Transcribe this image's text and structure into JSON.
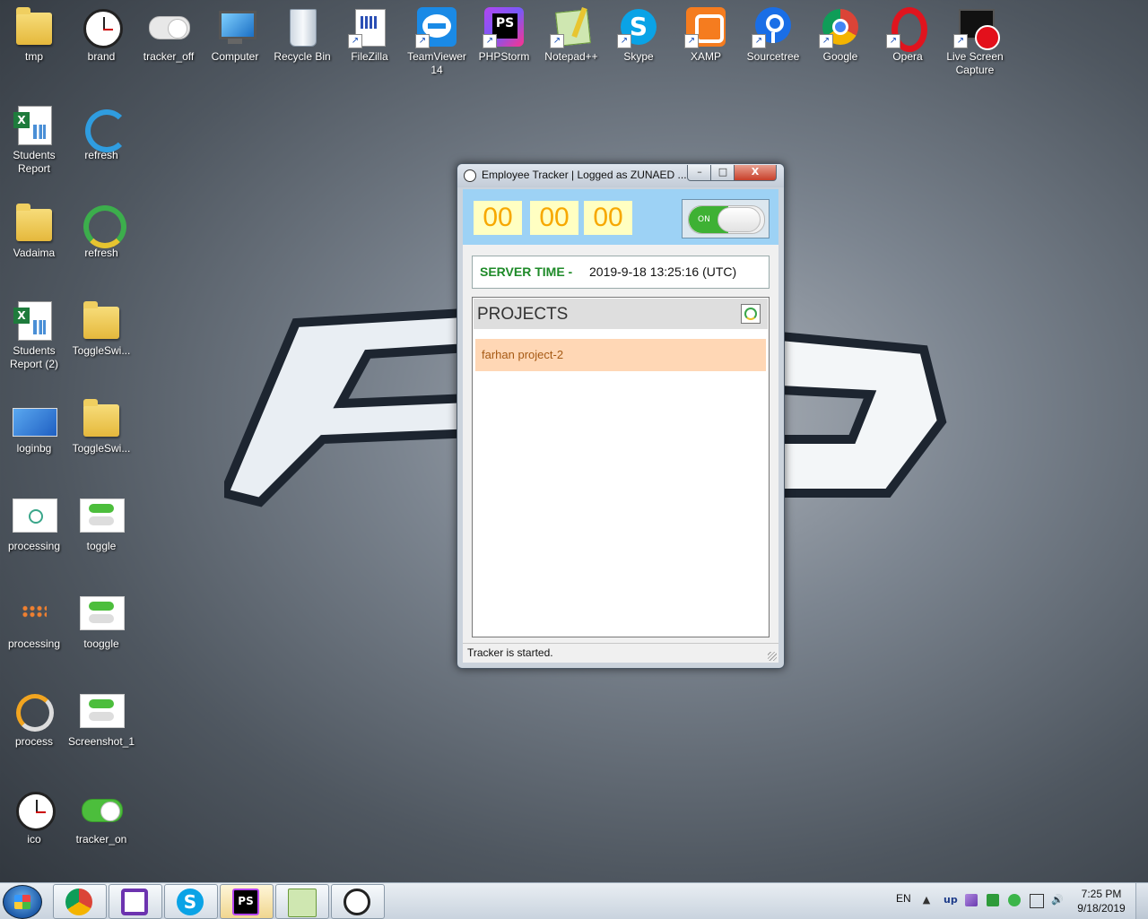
{
  "desktop": {
    "top_icons": [
      {
        "label": "tmp",
        "icon": "folder-icon"
      },
      {
        "label": "brand",
        "icon": "clock-icon"
      },
      {
        "label": "tracker_off",
        "icon": "toggle-off-icon"
      },
      {
        "label": "Computer",
        "icon": "computer-icon"
      },
      {
        "label": "Recycle Bin",
        "icon": "recycle-bin-icon"
      },
      {
        "label": "FileZilla",
        "icon": "filezilla-icon"
      },
      {
        "label": "TeamViewer 14",
        "icon": "teamviewer-icon"
      },
      {
        "label": "PHPStorm",
        "icon": "phpstorm-icon"
      },
      {
        "label": "Notepad++",
        "icon": "notepadpp-icon"
      },
      {
        "label": "Skype",
        "icon": "skype-icon"
      },
      {
        "label": "XAMP",
        "icon": "xampp-icon"
      },
      {
        "label": "Sourcetree",
        "icon": "sourcetree-icon"
      },
      {
        "label": "Google",
        "icon": "chrome-icon"
      },
      {
        "label": "Opera",
        "icon": "opera-icon"
      },
      {
        "label": "Live Screen Capture",
        "icon": "screen-capture-icon"
      }
    ],
    "left_icons": [
      {
        "label": "Students Report",
        "icon": "excel-icon"
      },
      {
        "label": "refresh",
        "icon": "refresh-arrow-icon"
      },
      {
        "label": "Vadaima",
        "icon": "folder-icon"
      },
      {
        "label": "refresh",
        "icon": "refresh-icon"
      },
      {
        "label": "Students Report (2)",
        "icon": "excel-icon"
      },
      {
        "label": "ToggleSwi...",
        "icon": "zip-folder-icon"
      },
      {
        "label": "loginbg",
        "icon": "image-icon"
      },
      {
        "label": "ToggleSwi...",
        "icon": "folder-icon"
      },
      {
        "label": "processing",
        "icon": "image-icon"
      },
      {
        "label": "toggle",
        "icon": "toggle-icon"
      },
      {
        "label": "processing",
        "icon": "image-icon"
      },
      {
        "label": "tooggle",
        "icon": "toggle-icon"
      },
      {
        "label": "process",
        "icon": "spinner-icon"
      },
      {
        "label": "Screenshot_1",
        "icon": "toggle-icon"
      },
      {
        "label": "ico",
        "icon": "clock-icon"
      },
      {
        "label": "tracker_on",
        "icon": "toggle-on-icon"
      }
    ]
  },
  "window": {
    "title": "Employee Tracker | Logged as ZUNAED ...",
    "controls": {
      "minimize": "–",
      "maximize": "□",
      "close": "X"
    },
    "timer": {
      "hours": "00",
      "minutes": "00",
      "seconds": "00"
    },
    "toggle": {
      "label": "ON",
      "state": "on"
    },
    "server_time": {
      "label": "SERVER TIME -",
      "value": "2019-9-18 13:25:16 (UTC)"
    },
    "projects": {
      "header": "PROJECTS",
      "items": [
        "farhan project-2"
      ]
    },
    "status": "Tracker is started.",
    "colors": {
      "timer_bg": "#9dd2f5",
      "digit_bg": "#ffffc2",
      "digit_fg": "#f7a800",
      "server_label": "#1e8a28",
      "project_bg": "#ffd7b5",
      "project_fg": "#a65a14"
    }
  },
  "taskbar": {
    "pinned": [
      "chrome-icon",
      "visual-studio-icon",
      "skype-icon",
      "phpstorm-icon",
      "notepadpp-icon",
      "clock-icon"
    ],
    "tray": {
      "lang": "EN",
      "up": "▲",
      "app": "up",
      "volume": "🔊"
    },
    "clock": {
      "time": "7:25 PM",
      "date": "9/18/2019"
    }
  }
}
